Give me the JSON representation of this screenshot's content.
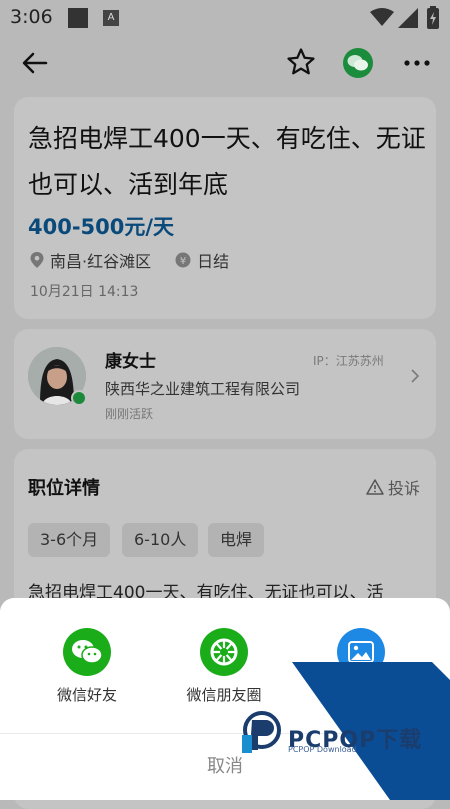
{
  "status": {
    "time": "3:06",
    "a_badge": "A"
  },
  "job": {
    "title": "急招电焊工400一天、有吃住、无证也可以、活到年底",
    "salary": "400-500元/天",
    "location": "南昌·红谷滩区",
    "pay_cycle": "日结",
    "date": "10月21日 14:13"
  },
  "recruiter": {
    "name": "康女士",
    "ip": "IP：江苏苏州",
    "company": "陕西华之业建筑工程有限公司",
    "activity": "刚刚活跃"
  },
  "details": {
    "section_title": "职位详情",
    "report_label": "投诉",
    "tags": [
      "3-6个月",
      "6-10人",
      "电焊"
    ],
    "description": "急招电焊工400一天、有吃住、无证也可以、活"
  },
  "share": {
    "items": [
      {
        "label": "微信好友",
        "icon": "wechat-friend-icon",
        "color": "#1aad19"
      },
      {
        "label": "微信朋友圈",
        "icon": "moments-icon",
        "color": "#1aad19"
      },
      {
        "label": "",
        "icon": "save-image-icon",
        "color": "#1e88e5"
      }
    ],
    "cancel_label": "取消"
  },
  "watermark": {
    "text": "PCPOP下载",
    "sub": "PCPOP Download"
  },
  "colors": {
    "accent_blue": "#1e6fbf",
    "wechat_green": "#1aad19",
    "overlay": "#b9b9b9"
  }
}
